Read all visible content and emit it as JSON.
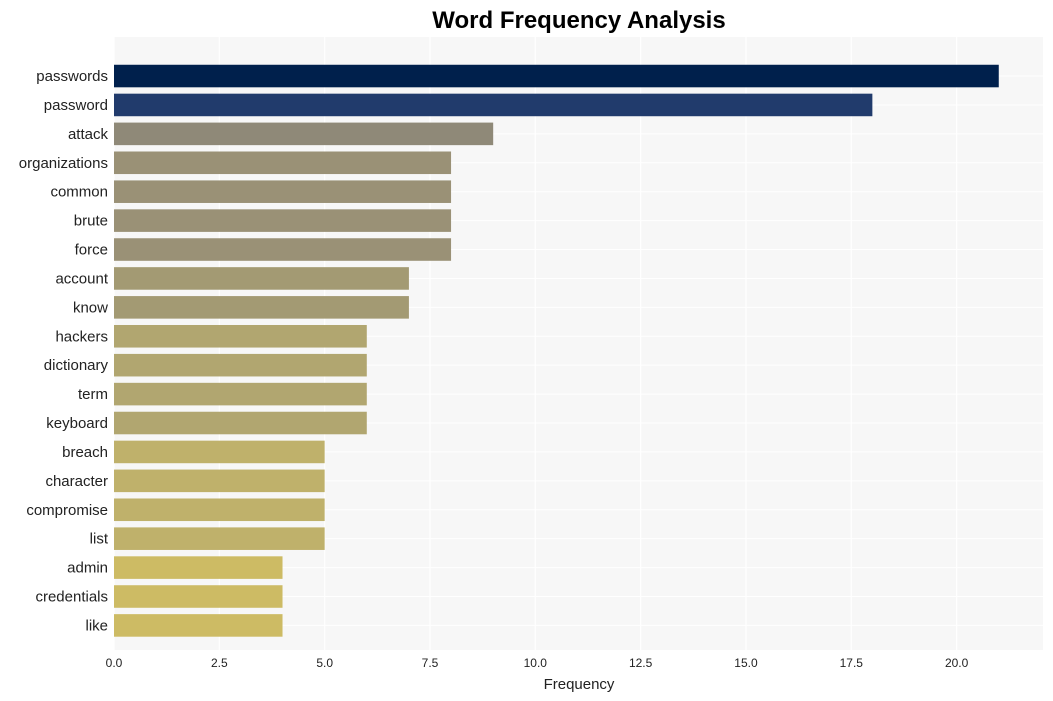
{
  "chart_data": {
    "type": "bar",
    "orientation": "horizontal",
    "title": "Word Frequency Analysis",
    "xlabel": "Frequency",
    "ylabel": "",
    "xlim": [
      0,
      22.05
    ],
    "xticks": [
      0.0,
      2.5,
      5.0,
      7.5,
      10.0,
      12.5,
      15.0,
      17.5,
      20.0
    ],
    "xtick_labels": [
      "0.0",
      "2.5",
      "5.0",
      "7.5",
      "10.0",
      "12.5",
      "15.0",
      "17.5",
      "20.0"
    ],
    "grid": true,
    "legend": "none",
    "categories": [
      "passwords",
      "password",
      "attack",
      "organizations",
      "common",
      "brute",
      "force",
      "account",
      "know",
      "hackers",
      "dictionary",
      "term",
      "keyboard",
      "breach",
      "character",
      "compromise",
      "list",
      "admin",
      "credentials",
      "like"
    ],
    "values": [
      21,
      18,
      9,
      8,
      8,
      8,
      8,
      7,
      7,
      6,
      6,
      6,
      6,
      5,
      5,
      5,
      5,
      4,
      4,
      4
    ],
    "colors": [
      "#00204c",
      "#213b6c",
      "#8f8978",
      "#9a9176",
      "#9a9176",
      "#9a9176",
      "#9a9176",
      "#a39a73",
      "#a39a73",
      "#b1a670",
      "#b1a670",
      "#b1a670",
      "#b1a670",
      "#bfb16b",
      "#bfb16b",
      "#bfb16b",
      "#bfb16b",
      "#cdbb64",
      "#cdbb64",
      "#cdbb64"
    ],
    "background_color": "#f7f7f7"
  }
}
